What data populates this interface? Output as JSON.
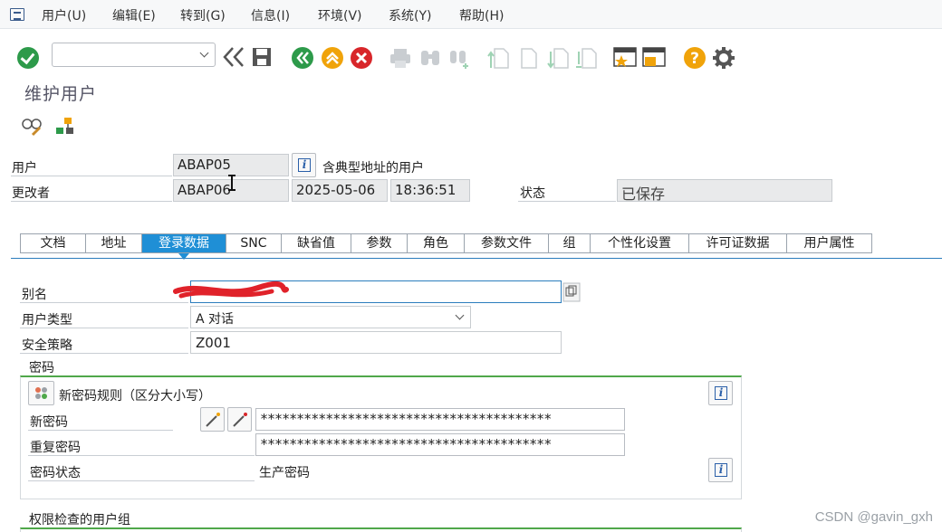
{
  "menu": {
    "items": [
      "用户(U)",
      "编辑(E)",
      "转到(G)",
      "信息(I)",
      "环境(V)",
      "系统(Y)",
      "帮助(H)"
    ]
  },
  "toolbar": {
    "command_value": ""
  },
  "page": {
    "title": "维护用户"
  },
  "header": {
    "user_label": "用户",
    "user_value": "ABAP05",
    "user_desc": "含典型地址的用户",
    "changed_by_label": "更改者",
    "changed_by_value": "ABAP06",
    "changed_date": "2025-05-06",
    "changed_time": "18:36:51",
    "status_label": "状态",
    "status_value": "已保存"
  },
  "tabs": [
    {
      "label": "文档"
    },
    {
      "label": "地址"
    },
    {
      "label": "登录数据"
    },
    {
      "label": "SNC"
    },
    {
      "label": "缺省值"
    },
    {
      "label": "参数"
    },
    {
      "label": "角色"
    },
    {
      "label": "参数文件"
    },
    {
      "label": "组"
    },
    {
      "label": "个性化设置"
    },
    {
      "label": "许可证数据"
    },
    {
      "label": "用户属性"
    }
  ],
  "logon": {
    "alias_label": "别名",
    "alias_value": "",
    "user_type_label": "用户类型",
    "user_type_value": "A 对话",
    "security_policy_label": "安全策略",
    "security_policy_value": "Z001"
  },
  "password": {
    "group_title": "密码",
    "rules_label": "新密码规则（区分大小写）",
    "new_pw_label": "新密码",
    "new_pw_value": "****************************************",
    "repeat_pw_label": "重复密码",
    "repeat_pw_value": "****************************************",
    "pw_status_label": "密码状态",
    "pw_status_value": "生产密码"
  },
  "auth_group": {
    "title": "权限检查的用户组"
  },
  "watermark": "CSDN @gavin_gxh"
}
